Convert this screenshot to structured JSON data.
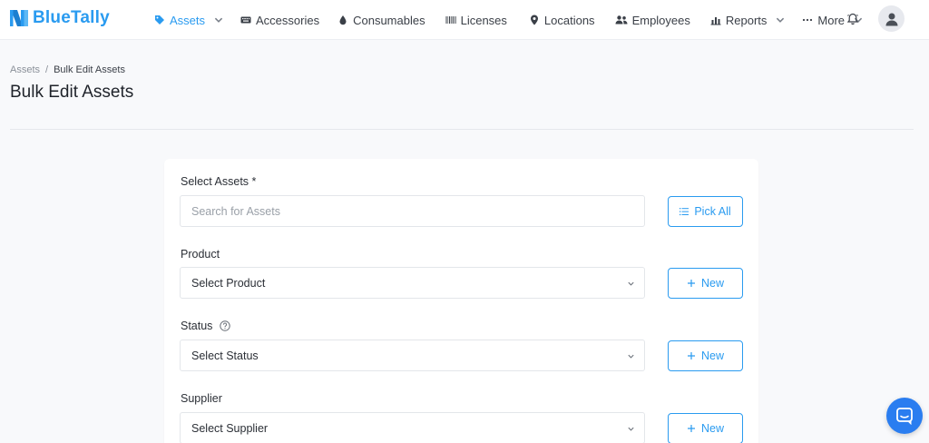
{
  "app": {
    "name": "BlueTally"
  },
  "colors": {
    "accent": "#2a9bf0",
    "chat": "#2a7df0"
  },
  "nav": {
    "items": [
      {
        "label": "Assets",
        "icon": "tag-icon",
        "active": true,
        "dropdown": true
      },
      {
        "label": "Accessories",
        "icon": "keyboard-icon",
        "active": false,
        "dropdown": false
      },
      {
        "label": "Consumables",
        "icon": "drop-icon",
        "active": false,
        "dropdown": false
      },
      {
        "label": "Licenses",
        "icon": "barcode-icon",
        "active": false,
        "dropdown": false
      },
      {
        "label": "Locations",
        "icon": "map-pin-icon",
        "active": false,
        "dropdown": false
      },
      {
        "label": "Employees",
        "icon": "users-icon",
        "active": false,
        "dropdown": false
      },
      {
        "label": "Reports",
        "icon": "bar-chart-icon",
        "active": false,
        "dropdown": true
      },
      {
        "label": "More",
        "icon": "ellipsis-icon",
        "active": false,
        "dropdown": true
      }
    ]
  },
  "header_icons": {
    "notifications": "bell-icon",
    "profile": "user-avatar-icon"
  },
  "breadcrumb": {
    "root": "Assets",
    "separator": "/",
    "current": "Bulk Edit Assets"
  },
  "page": {
    "title": "Bulk Edit Assets"
  },
  "form": {
    "select_assets": {
      "label": "Select Assets *",
      "placeholder": "Search for Assets",
      "button": "Pick All"
    },
    "product": {
      "label": "Product",
      "value": "Select Product",
      "button": "New"
    },
    "status": {
      "label": "Status",
      "value": "Select Status",
      "button": "New",
      "help_icon": "question-circle-icon"
    },
    "supplier": {
      "label": "Supplier",
      "value": "Select Supplier",
      "button": "New"
    }
  },
  "chat": {
    "icon": "chat-icon"
  }
}
